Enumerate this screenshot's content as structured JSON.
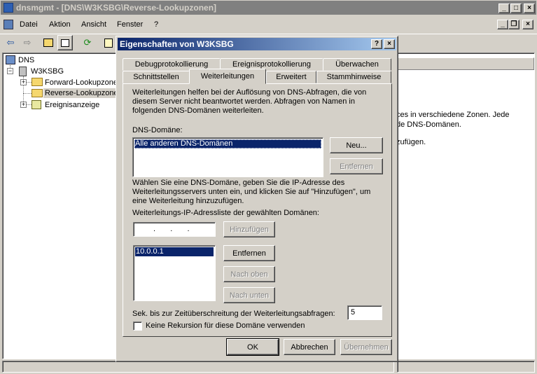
{
  "main_window": {
    "title": "dnsmgmt - [DNS\\W3KSBG\\Reverse-Lookupzonen]"
  },
  "menu": {
    "items": [
      "Datei",
      "Aktion",
      "Ansicht",
      "Fenster",
      "?"
    ]
  },
  "tree": {
    "root": "DNS",
    "server": "W3KSBG",
    "children": [
      "Forward-Lookupzone",
      "Reverse-Lookupzone",
      "Ereignisanzeige"
    ]
  },
  "right_pane": {
    "lines": [
      "ces in verschiedene Zonen. Jede",
      "de DNS-Domänen.",
      "zufügen."
    ]
  },
  "dialog": {
    "title": "Eigenschaften von W3KSBG",
    "help_glyph": "?",
    "close_glyph": "×",
    "tabs_row1": [
      "Debugprotokollierung",
      "Ereignisprotokollierung",
      "Überwachen"
    ],
    "tabs_row2": [
      "Schnittstellen",
      "Weiterleitungen",
      "Erweitert",
      "Stammhinweise"
    ],
    "intro_text": [
      "Weiterleitungen helfen bei der Auflösung von DNS-Abfragen, die von",
      "diesem Server nicht beantwortet werden. Abfragen von Namen in",
      "folgenden DNS-Domänen weiterleiten."
    ],
    "dns_domain_label": "DNS-Domäne:",
    "dns_domains": [
      "Alle anderen DNS-Domänen"
    ],
    "new_button": "Neu...",
    "remove_domain_button": "Entfernen",
    "instruction_text": [
      "Wählen Sie eine DNS-Domäne, geben Sie die IP-Adresse des",
      "Weiterleitungsservers unten ein, und klicken Sie auf \"Hinzufügen\", um",
      "eine Weiterleitung hinzuzufügen."
    ],
    "ip_list_label": "Weiterleitungs-IP-Adressliste der gewählten Domänen:",
    "ip_input_dots": ".   .   .",
    "add_button": "Hinzufügen",
    "ip_addresses": [
      "10.0.0.1"
    ],
    "remove_ip_button": "Entfernen",
    "move_up_button": "Nach oben",
    "move_down_button": "Nach unten",
    "timeout_label": "Sek. bis zur Zeitüberschreitung der Weiterleitungsabfragen:",
    "timeout_value": "5",
    "no_recursion_label": "Keine Rekursion für diese Domäne verwenden",
    "no_recursion_checked": false,
    "ok_button": "OK",
    "cancel_button": "Abbrechen",
    "apply_button": "Übernehmen"
  }
}
